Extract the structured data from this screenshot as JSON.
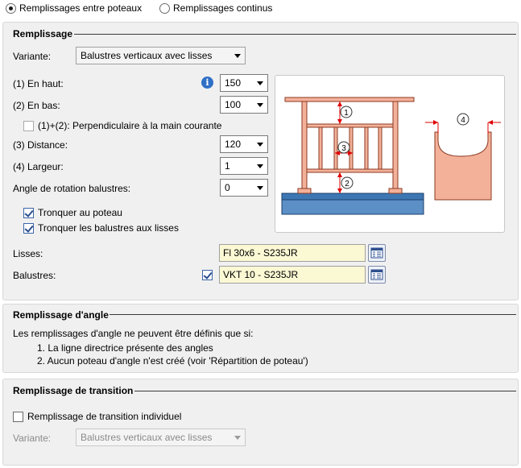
{
  "top": {
    "radio_between": "Remplissages entre poteaux",
    "radio_continuous": "Remplissages continus"
  },
  "remplissage": {
    "title": "Remplissage",
    "variante_label": "Variante:",
    "variante_value": "Balustres verticaux avec lisses",
    "en_haut_label": "(1) En haut:",
    "en_haut_value": "150",
    "en_bas_label": "(2) En bas:",
    "en_bas_value": "100",
    "perp_label": "(1)+(2): Perpendiculaire à la main courante",
    "distance_label": "(3) Distance:",
    "distance_value": "120",
    "largeur_label": "(4) Largeur:",
    "largeur_value": "1",
    "angle_label": "Angle de rotation balustres:",
    "angle_value": "0",
    "tronquer_poteau_label": "Tronquer au poteau",
    "tronquer_lisses_label": "Tronquer les balustres aux lisses",
    "lisses_label": "Lisses:",
    "lisses_value": "Fl 30x6 - S235JR",
    "balustres_label": "Balustres:",
    "balustres_value": "VKT 10 - S235JR",
    "info_icon_glyph": "i",
    "diagram_marks": [
      "1",
      "2",
      "3",
      "4"
    ]
  },
  "angle": {
    "title": "Remplissage d'angle",
    "intro": "Les remplissages d'angle ne peuvent être définis que si:",
    "item1": "1. La ligne directrice présente des angles",
    "item2": "2. Aucun poteau d'angle n'est créé (voir 'Répartition de poteau')"
  },
  "transition": {
    "title": "Remplissage de transition",
    "individuel_label": "Remplissage de transition individuel",
    "variante_label": "Variante:",
    "variante_value": "Balustres verticaux avec lisses"
  },
  "colors": {
    "panel_bg": "#f0f0f0",
    "input_yellow": "#fbf8d4",
    "post_fill": "#f4b19a",
    "post_stroke": "#8b3a22",
    "base_fill": "#3d77b3",
    "dim_red": "#e00000"
  },
  "icons": [
    "info-icon",
    "library-icon",
    "chevron-down-icon"
  ]
}
